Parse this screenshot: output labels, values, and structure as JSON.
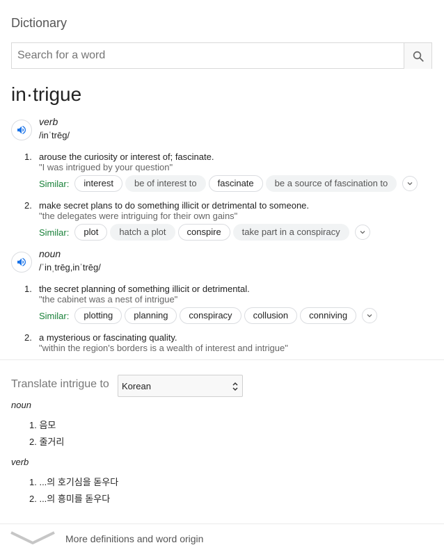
{
  "header": {
    "title": "Dictionary"
  },
  "search": {
    "placeholder": "Search for a word",
    "value": ""
  },
  "headword": "in·trigue",
  "entries": [
    {
      "pos": "verb",
      "pronunciation": "/inˈtrēɡ/",
      "senses": [
        {
          "number": "1.",
          "definition": "arouse the curiosity or interest of; fascinate.",
          "example": "\"I was intrigued by your question\"",
          "similar_label": "Similar:",
          "similar": [
            "interest",
            "be of interest to",
            "fascinate",
            "be a source of fascination to"
          ]
        },
        {
          "number": "2.",
          "definition": "make secret plans to do something illicit or detrimental to someone.",
          "example": "\"the delegates were intriguing for their own gains\"",
          "similar_label": "Similar:",
          "similar": [
            "plot",
            "hatch a plot",
            "conspire",
            "take part in a conspiracy"
          ]
        }
      ]
    },
    {
      "pos": "noun",
      "pronunciation": "/ˈinˌtrēɡ,inˈtrēɡ/",
      "senses": [
        {
          "number": "1.",
          "definition": "the secret planning of something illicit or detrimental.",
          "example": "\"the cabinet was a nest of intrigue\"",
          "similar_label": "Similar:",
          "similar": [
            "plotting",
            "planning",
            "conspiracy",
            "collusion",
            "conniving"
          ]
        },
        {
          "number": "2.",
          "definition": "a mysterious or fascinating quality.",
          "example": "\"within the region's borders is a wealth of interest and intrigue\""
        }
      ]
    }
  ],
  "translate": {
    "label": "Translate intrigue to",
    "language": "Korean",
    "groups": [
      {
        "pos": "noun",
        "items": [
          "1. 음모",
          "2. 줄거리"
        ]
      },
      {
        "pos": "verb",
        "items": [
          "1. ...의 호기심을 돋우다",
          "2. ...의 흥미를 돋우다"
        ]
      }
    ]
  },
  "footer": {
    "more_label": "More definitions and word origin"
  },
  "icons": {
    "search": "search-icon",
    "audio": "speaker-icon",
    "expand": "chevron-down-icon",
    "select": "select-arrows-icon",
    "more": "chevron-down-icon"
  },
  "colors": {
    "similar_label": "#188038",
    "audio": "#1a73e8",
    "example": "#666666"
  }
}
